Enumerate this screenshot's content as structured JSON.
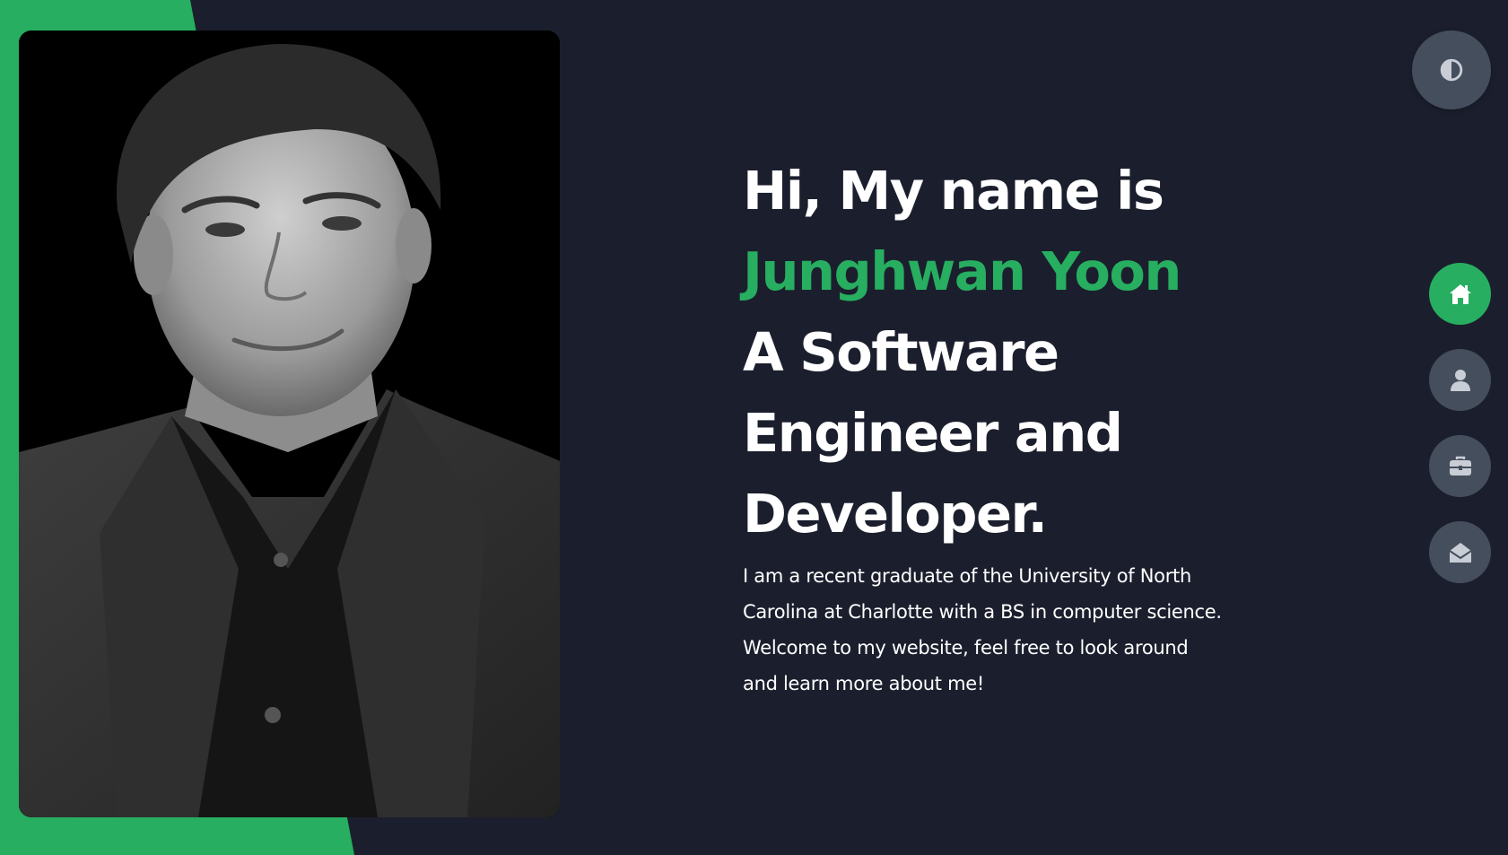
{
  "hero": {
    "greeting": "Hi, My name is",
    "name": "Junghwan Yoon",
    "role_line1": "A Software",
    "role_line2": "Engineer and",
    "role_line3": "Developer.",
    "intro": "I am a recent graduate of the University of North Carolina at Charlotte with a BS in computer science. Welcome to my website, feel free to look around and learn more about me!"
  },
  "colors": {
    "background": "#1b1f2d",
    "accent": "#27ae60",
    "button": "#454e5d",
    "icon": "#c9ced6"
  },
  "theme_toggle": {
    "icon": "contrast-icon"
  },
  "nav": [
    {
      "id": "home",
      "icon": "home-icon",
      "active": true
    },
    {
      "id": "about",
      "icon": "user-icon",
      "active": false
    },
    {
      "id": "portfolio",
      "icon": "briefcase-icon",
      "active": false
    },
    {
      "id": "contact",
      "icon": "envelope-open-icon",
      "active": false
    }
  ]
}
